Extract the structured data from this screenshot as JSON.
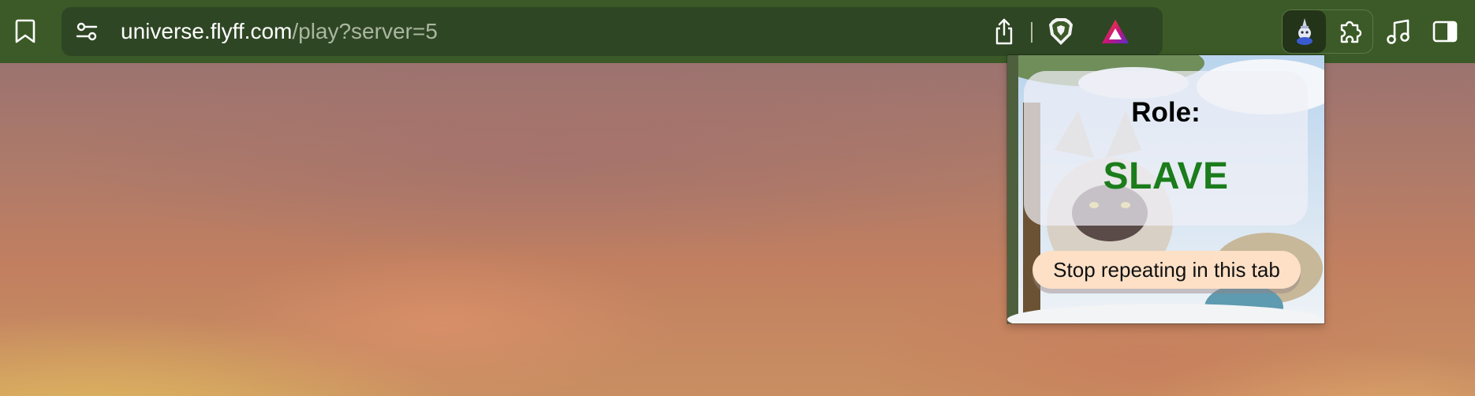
{
  "browser": {
    "url_host": "universe.flyff.com",
    "url_path": "/play?server=5",
    "icons": {
      "bookmark": "bookmark-icon",
      "site_settings": "site-settings-icon",
      "share": "share-icon",
      "brave_shields": "brave-shields-icon",
      "brave_rewards": "brave-rewards-icon",
      "extension_active": "extension-icon",
      "extensions_menu": "puzzle-piece-icon",
      "media": "music-note-icon",
      "sidebar": "sidebar-icon"
    }
  },
  "popup": {
    "role_label": "Role:",
    "role_value": "SLAVE",
    "stop_button_label": "Stop repeating in this tab"
  },
  "colors": {
    "toolbar": "#3b5a27",
    "urlbar": "#2f4624",
    "role_value": "#1b7c1b",
    "stop_button": "#fde0c6"
  }
}
